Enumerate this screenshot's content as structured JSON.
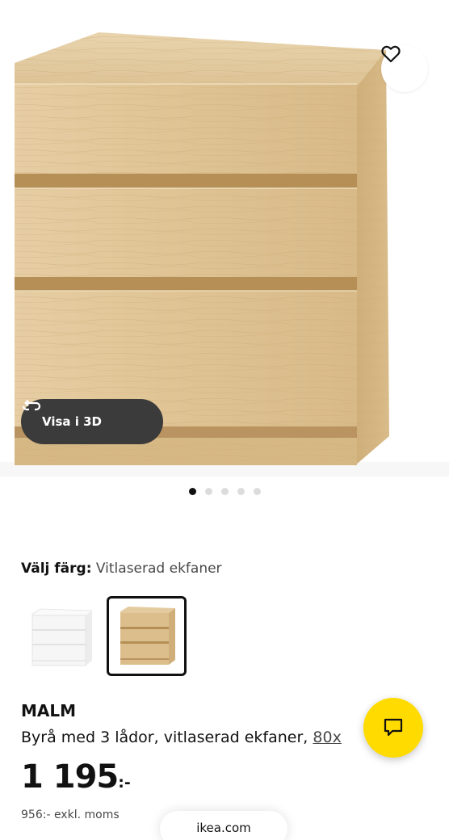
{
  "product_image": {
    "alt": "MALM Byrå med 3 lådor, vitlaserad ekfaner",
    "favorite_icon": "heart-outline-icon",
    "view_3d_label": "Visa i 3D",
    "view_3d_icon": "rotate-3d-icon"
  },
  "carousel": {
    "total": 5,
    "active": 1
  },
  "color_picker": {
    "label": "Välj färg:",
    "selected_value": "Vitlaserad ekfaner",
    "options": [
      {
        "name": "Vit",
        "selected": false,
        "color": "#f4f4f4"
      },
      {
        "name": "Vitlaserad ekfaner",
        "selected": true,
        "color": "#d9b981"
      }
    ]
  },
  "product": {
    "name": "MALM",
    "description": "Byrå med 3 lådor, vitlaserad ekfaner, ",
    "size_link": "80x",
    "price_main": "1 195",
    "price_suffix": ":-",
    "price_excl_vat": "956:- exkl. moms"
  },
  "browser": {
    "url": "ikea.com"
  },
  "chat": {
    "icon": "chat-bubble-icon",
    "color": "#ffdb00"
  }
}
